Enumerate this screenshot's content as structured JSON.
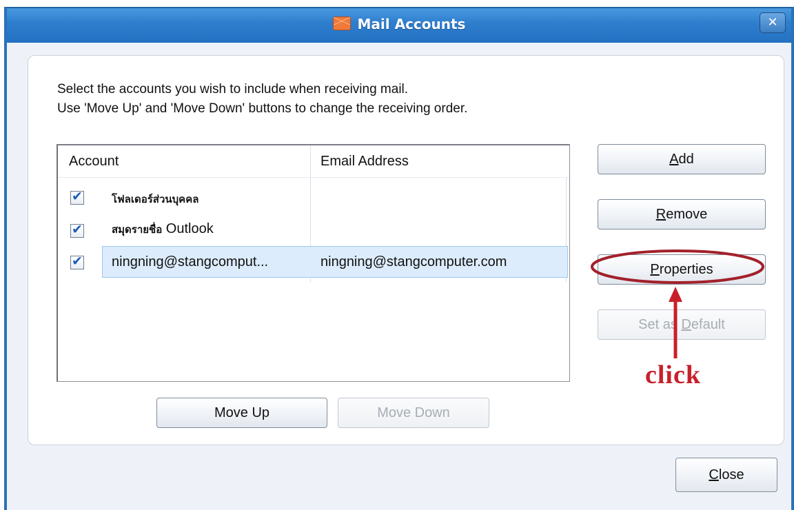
{
  "window": {
    "title": "Mail Accounts",
    "close_glyph": "✕"
  },
  "instructions": {
    "line1": "Select the accounts you wish to include when receiving mail.",
    "line2": "Use 'Move Up' and 'Move Down' buttons to change the receiving order."
  },
  "table": {
    "columns": [
      "Account",
      "Email Address"
    ],
    "rows": [
      {
        "checked": true,
        "account": "โฟลเดอร์ส่วนบุคคล",
        "email": ""
      },
      {
        "checked": true,
        "account": "สมุดรายชื่อ Outlook",
        "email": ""
      },
      {
        "checked": true,
        "account": "ningning@stangcomput...",
        "email": "ningning@stangcomputer.com",
        "selected": true
      }
    ]
  },
  "buttons": {
    "add": "Add",
    "remove": "Remove",
    "properties": "Properties",
    "set_default": "Set as Default",
    "move_up": "Move Up",
    "move_down": "Move Down",
    "close": "Close"
  },
  "annotation": {
    "text": "click",
    "color": "#c8202a"
  },
  "icons": {
    "title_icon": "mail-envelope-icon",
    "checkbox": "checkmark-icon",
    "arrow": "arrow-up-icon"
  }
}
